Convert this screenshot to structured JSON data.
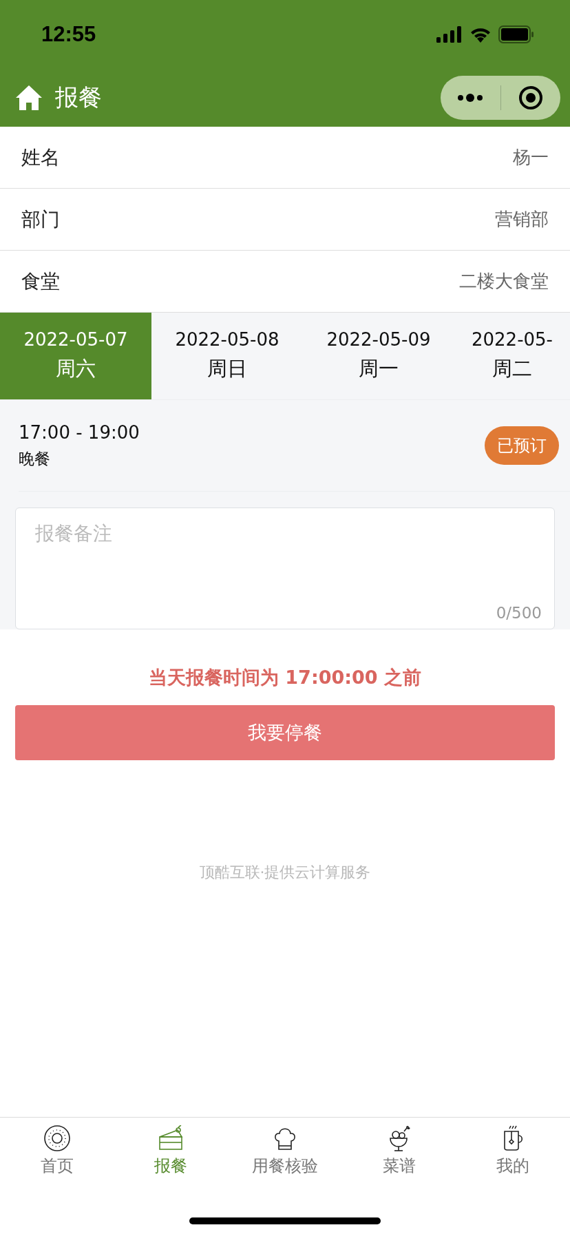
{
  "status_bar": {
    "time": "12:55"
  },
  "nav_bar": {
    "title": "报餐"
  },
  "info_rows": [
    {
      "label": "姓名",
      "value": "杨一"
    },
    {
      "label": "部门",
      "value": "营销部"
    },
    {
      "label": "食堂",
      "value": "二楼大食堂"
    }
  ],
  "date_tabs": [
    {
      "date": "2022-05-07",
      "weekday": "周六",
      "selected": true
    },
    {
      "date": "2022-05-08",
      "weekday": "周日",
      "selected": false
    },
    {
      "date": "2022-05-09",
      "weekday": "周一",
      "selected": false
    },
    {
      "date": "2022-05-",
      "weekday": "周二",
      "selected": false
    }
  ],
  "meal": {
    "time": "17:00 - 19:00",
    "name": "晚餐",
    "status": "已预订"
  },
  "remark": {
    "placeholder": "报餐备注",
    "counter": "0/500"
  },
  "notice": "当天报餐时间为 17:00:00 之前",
  "action_button": "我要停餐",
  "footer": "顶酷互联·提供云计算服务",
  "tab_bar": [
    {
      "label": "首页",
      "kind": "donut",
      "selected": false
    },
    {
      "label": "报餐",
      "kind": "cake",
      "selected": true
    },
    {
      "label": "用餐核验",
      "kind": "chef",
      "selected": false
    },
    {
      "label": "菜谱",
      "kind": "icecream",
      "selected": false
    },
    {
      "label": "我的",
      "kind": "mug",
      "selected": false
    }
  ]
}
